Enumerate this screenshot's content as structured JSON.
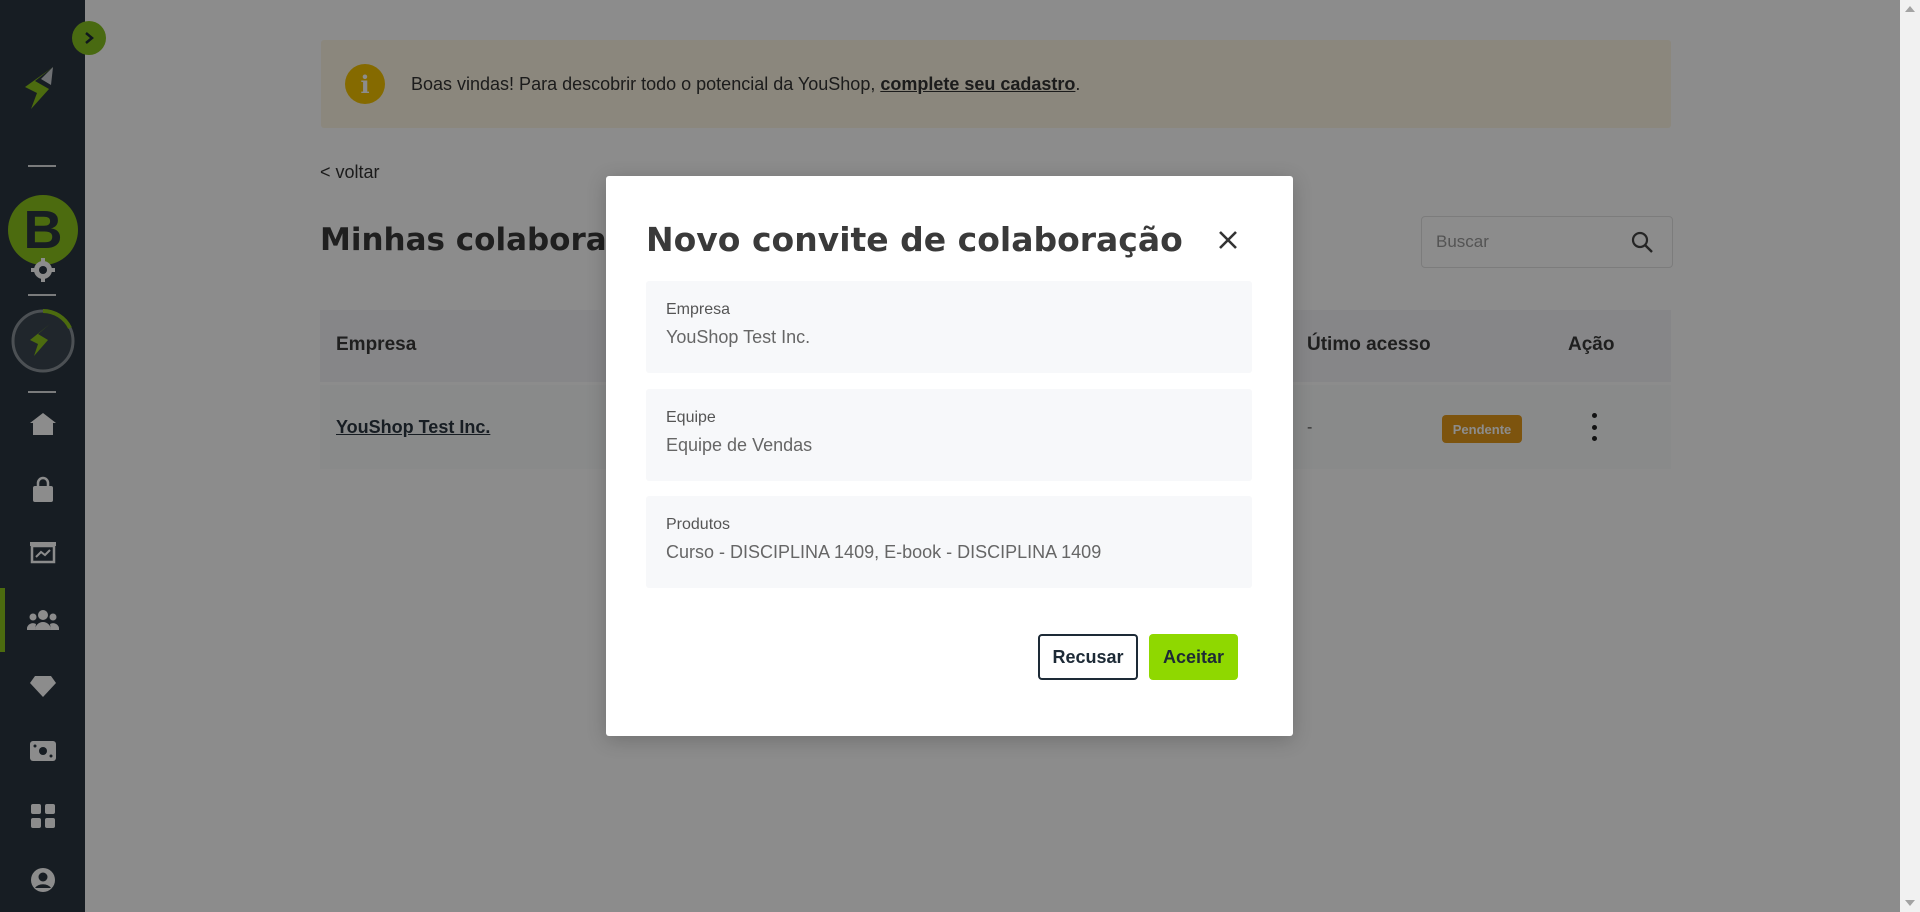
{
  "banner": {
    "text": "Boas vindas! Para descobrir todo o potencial da YouShop, ",
    "link": "complete seu cadastro",
    "suffix": ".",
    "icon": "info-icon"
  },
  "back_label": "< voltar",
  "page_title": "Minhas colaborações",
  "search": {
    "placeholder": "Buscar"
  },
  "table": {
    "headers": {
      "company": "Empresa",
      "last_access": "Útimo acesso",
      "action": "Ação"
    },
    "rows": [
      {
        "company": "YouShop Test Inc.",
        "last_access": "-",
        "status": "Pendente"
      }
    ]
  },
  "sidebar": {
    "avatar_letter": "B",
    "items": [
      "logo-icon",
      "settings-icon",
      "store-icon",
      "home-icon",
      "bag-icon",
      "presentation-icon",
      "team-icon",
      "diamond-icon",
      "money-icon",
      "apps-icon",
      "user-icon"
    ]
  },
  "modal": {
    "title": "Novo convite de colaboração",
    "fields": [
      {
        "label": "Empresa",
        "value": "YouShop Test Inc."
      },
      {
        "label": "Equipe",
        "value": "Equipe de Vendas"
      },
      {
        "label": "Produtos",
        "value": "Curso - DISCIPLINA 1409, E-book - DISCIPLINA 1409"
      }
    ],
    "decline": "Recusar",
    "accept": "Aceitar"
  },
  "colors": {
    "sidebar": "#2b3640",
    "accent": "#8bc31c",
    "badge": "#e39a1b",
    "accept_button": "#8fd800"
  }
}
